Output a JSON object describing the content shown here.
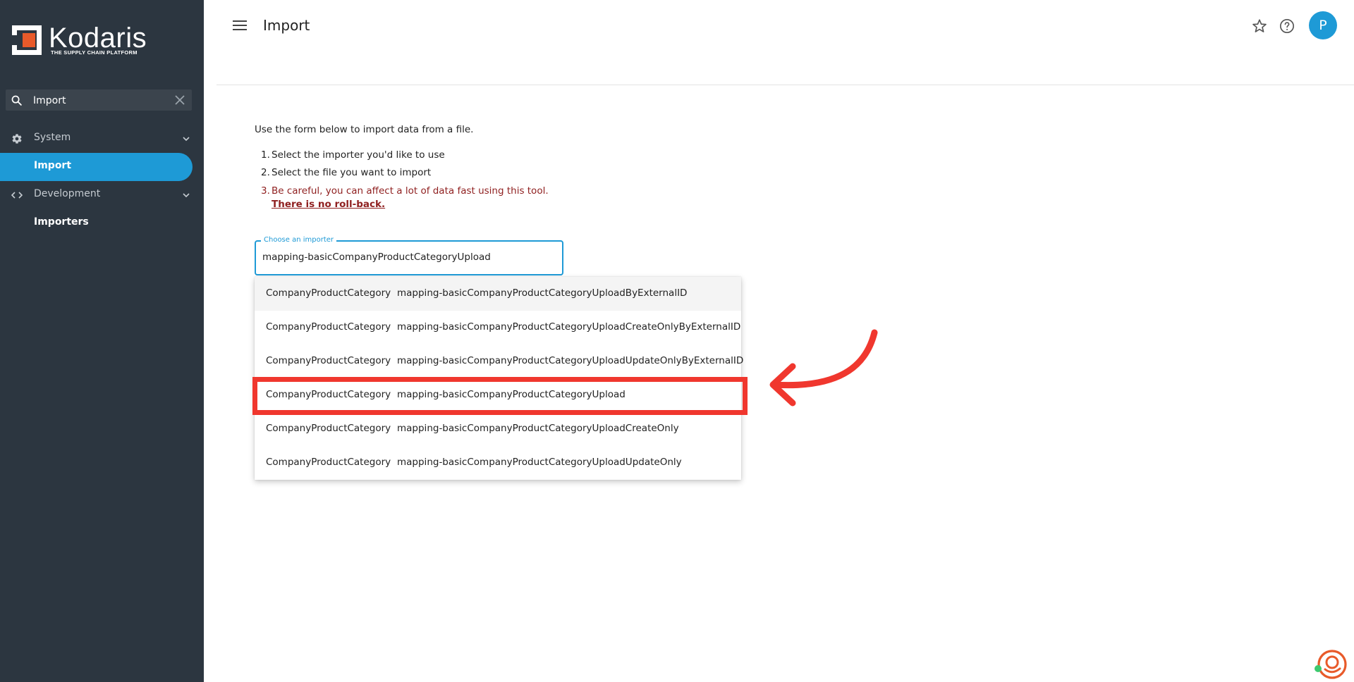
{
  "brand": {
    "name": "Kodaris",
    "tagline": "THE SUPPLY CHAIN PLATFORM",
    "accent": "#1e9ad6",
    "logo_orange": "#e85a2a"
  },
  "sidebar": {
    "search": {
      "value": "Import",
      "placeholder": "Search"
    },
    "items": [
      {
        "label": "System",
        "icon": "gear-icon"
      },
      {
        "label": "Import",
        "active": true
      },
      {
        "label": "Development",
        "icon": "code-icon"
      },
      {
        "label": "Importers"
      }
    ]
  },
  "header": {
    "title": "Import",
    "avatar_letter": "P"
  },
  "content": {
    "intro": "Use the form below to import data from a file.",
    "steps": [
      {
        "num": "1.",
        "text": "Select the importer you'd like to use"
      },
      {
        "num": "2.",
        "text": "Select the file you want to import"
      },
      {
        "num": "3.",
        "text": "Be careful, you can affect a lot of data fast using this tool.",
        "strong": "There is no roll-back."
      }
    ],
    "importer_field": {
      "label": "Choose an importer",
      "value": "mapping-basicCompanyProductCategoryUpload"
    },
    "options": [
      {
        "type": "CompanyProductCategory",
        "name": "mapping-basicCompanyProductCategoryUploadByExternalID"
      },
      {
        "type": "CompanyProductCategory",
        "name": "mapping-basicCompanyProductCategoryUploadCreateOnlyByExternalID"
      },
      {
        "type": "CompanyProductCategory",
        "name": "mapping-basicCompanyProductCategoryUploadUpdateOnlyByExternalID"
      },
      {
        "type": "CompanyProductCategory",
        "name": "mapping-basicCompanyProductCategoryUpload"
      },
      {
        "type": "CompanyProductCategory",
        "name": "mapping-basicCompanyProductCategoryUploadCreateOnly"
      },
      {
        "type": "CompanyProductCategory",
        "name": "mapping-basicCompanyProductCategoryUploadUpdateOnly"
      }
    ]
  },
  "annotation": {
    "color": "#f0372e"
  }
}
